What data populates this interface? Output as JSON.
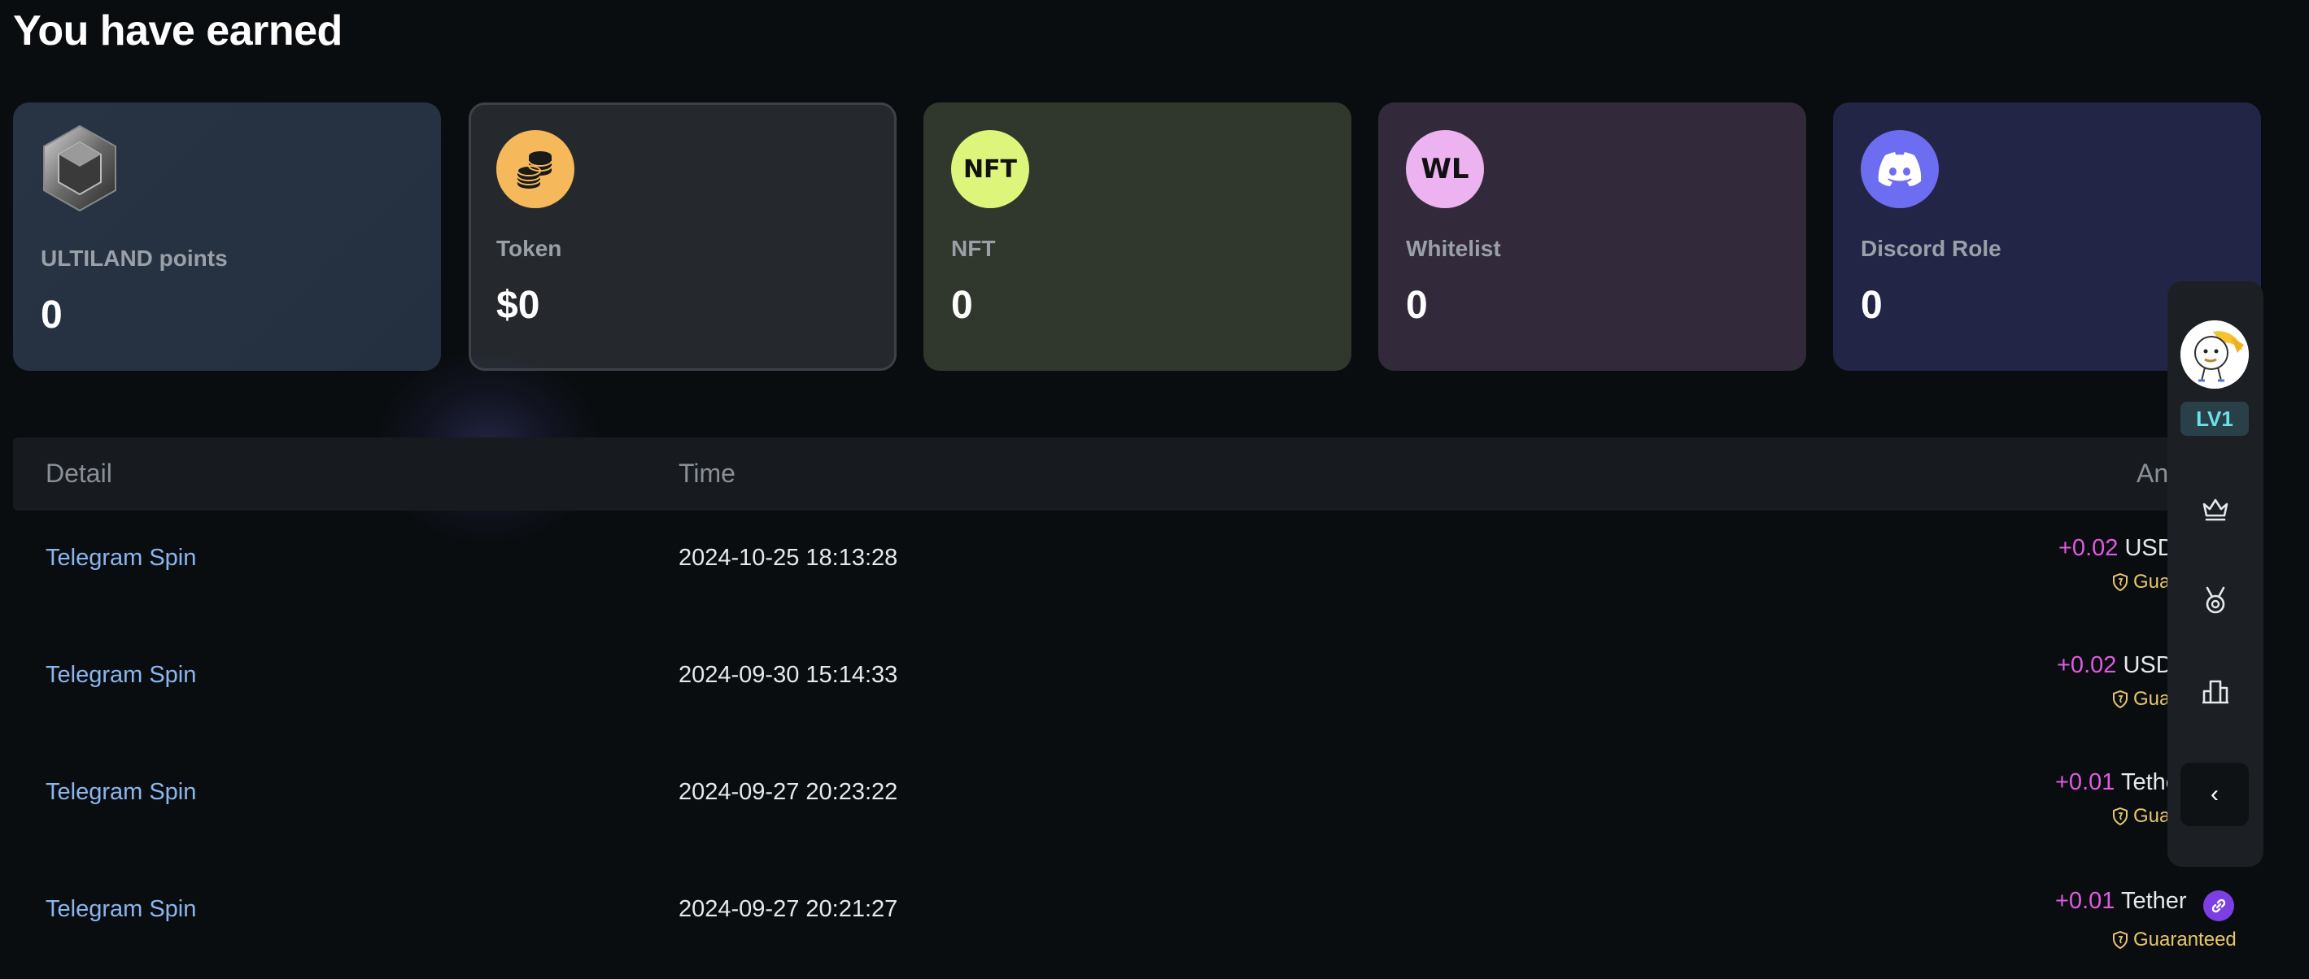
{
  "page": {
    "title": "You have earned"
  },
  "cards": [
    {
      "label": "ULTILAND points",
      "value": "0",
      "icon": "gem-icon"
    },
    {
      "label": "Token",
      "value": "$0",
      "icon": "coins-icon",
      "color": "#f5b85a"
    },
    {
      "label": "NFT",
      "value": "0",
      "icon_text": "NFT",
      "color": "#dcf57a"
    },
    {
      "label": "Whitelist",
      "value": "0",
      "icon_text": "WL",
      "color": "#ecb3f0"
    },
    {
      "label": "Discord Role",
      "value": "0",
      "icon": "discord-icon",
      "color": "#6c6df0"
    }
  ],
  "table": {
    "headers": [
      "Detail",
      "Time",
      "An"
    ],
    "rows": [
      {
        "detail": "Telegram Spin",
        "time": "2024-10-25 18:13:28",
        "amount": "+0.02",
        "currency": "USD",
        "tag": "Guar"
      },
      {
        "detail": "Telegram Spin",
        "time": "2024-09-30 15:14:33",
        "amount": "+0.02",
        "currency": "USD",
        "tag": "Guar"
      },
      {
        "detail": "Telegram Spin",
        "time": "2024-09-27 20:23:22",
        "amount": "+0.01",
        "currency": "Tethe",
        "tag": "Guar"
      },
      {
        "detail": "Telegram Spin",
        "time": "2024-09-27 20:21:27",
        "amount": "+0.01",
        "currency": "Tether",
        "tag": "Guaranteed"
      }
    ]
  },
  "sidebar": {
    "level": "LV1",
    "icons": [
      "crown-icon",
      "medal-icon",
      "leaderboard-icon"
    ],
    "collapse_label": "‹"
  },
  "colors": {
    "accent_amount": "#e05ae0",
    "link": "#8ab6ee",
    "guaranteed": "#e8c66a",
    "level": "#6ee0ea"
  }
}
